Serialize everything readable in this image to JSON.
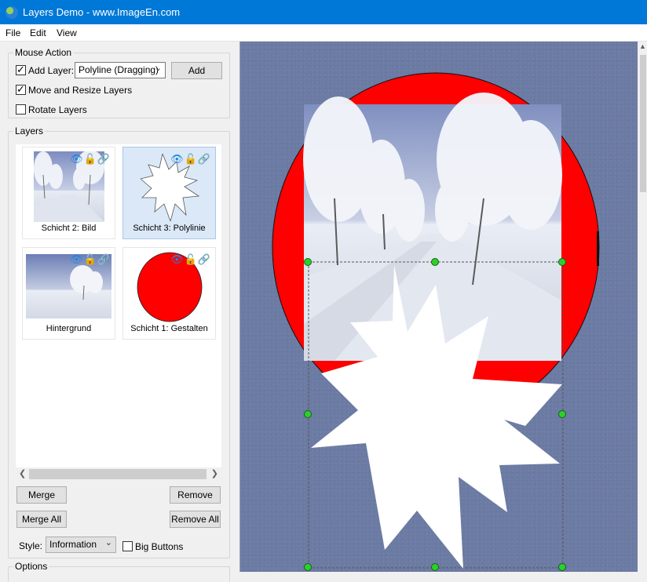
{
  "window": {
    "title": "Layers Demo  - www.ImageEn.com"
  },
  "menu": {
    "items": [
      "File",
      "Edit",
      "View"
    ]
  },
  "mouse_action": {
    "title": "Mouse Action",
    "add_layer_label": "Add Layer:",
    "add_layer_checked": true,
    "layer_type_selected": "Polyline (Dragging)",
    "add_button": "Add",
    "move_resize_label": "Move and Resize Layers",
    "move_resize_checked": true,
    "rotate_label": "Rotate Layers",
    "rotate_checked": false
  },
  "layers": {
    "title": "Layers",
    "items": [
      {
        "caption": "Schicht 2: Bild",
        "selected": false
      },
      {
        "caption": "Schicht 3: Polylinie",
        "selected": true
      },
      {
        "caption": "Hintergrund",
        "selected": false
      },
      {
        "caption": "Schicht 1: Gestalten",
        "selected": false
      }
    ],
    "buttons": {
      "merge": "Merge",
      "remove": "Remove",
      "merge_all": "Merge All",
      "remove_all": "Remove All"
    },
    "style_label": "Style:",
    "style_selected": "Information",
    "big_buttons_label": "Big Buttons",
    "big_buttons_checked": false
  },
  "options": {
    "title": "Options"
  },
  "colors": {
    "accent": "#0078d7",
    "circle": "#ff0000",
    "handle": "#2ad12a",
    "canvas": "#6c7ba3",
    "icon": "#1e88e5"
  },
  "icons": [
    "app-icon",
    "eye-icon",
    "lock-icon",
    "link-icon",
    "chevron-down-icon"
  ]
}
